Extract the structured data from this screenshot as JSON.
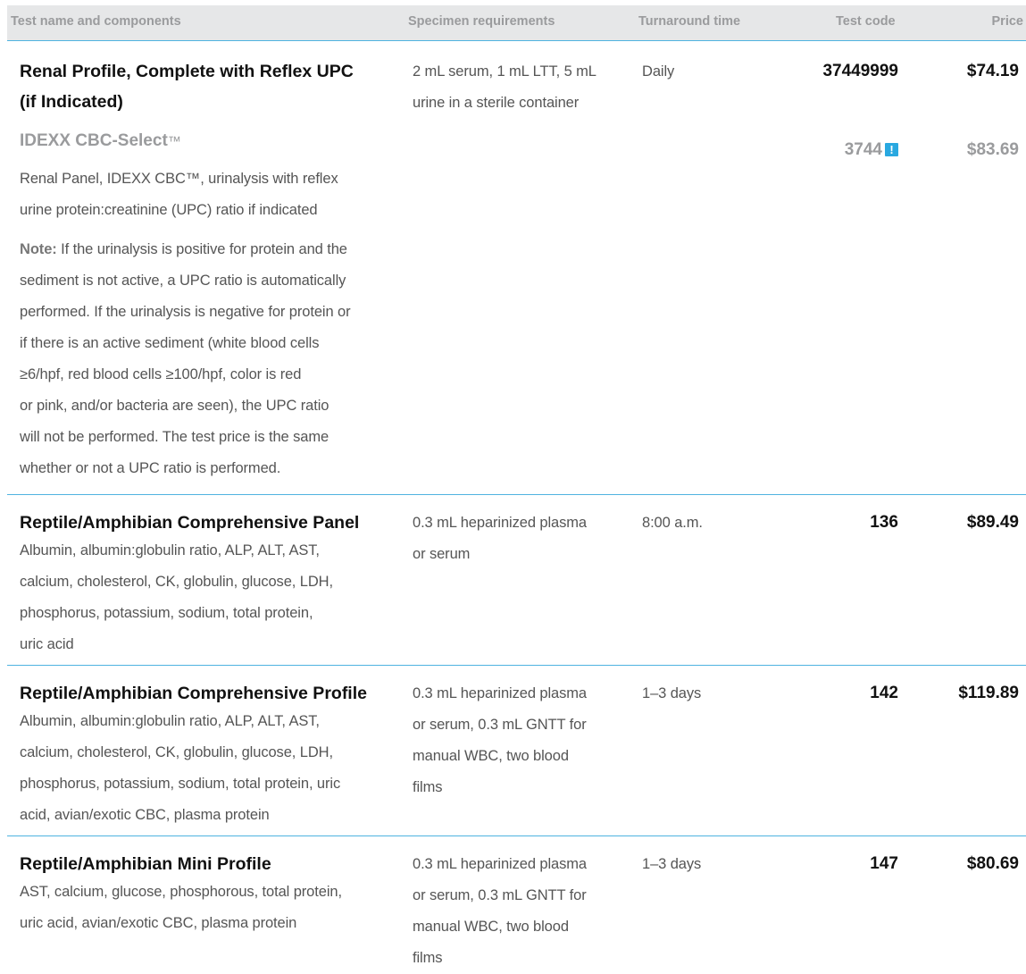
{
  "header": {
    "name": "Test name and components",
    "specimen": "Specimen requirements",
    "turnaround": "Turnaround time",
    "code": "Test code",
    "price": "Price"
  },
  "rows": [
    {
      "title_lines": [
        "Renal Profile, Complete with Reflex UPC",
        "(if Indicated)"
      ],
      "specimen_lines": [
        "2 mL serum, 1 mL LTT, 5 mL",
        "urine in a sterile container"
      ],
      "turnaround": "Daily",
      "code": "37449999",
      "price": "$74.19",
      "variant": {
        "title": "IDEXX CBC-Select",
        "trademark": "™",
        "code": "3744",
        "icon": "exclamation-icon",
        "price": "$83.69"
      },
      "components_lines": [
        "Renal Panel, IDEXX CBC™, urinalysis with reflex",
        "urine protein:creatinine (UPC) ratio if indicated"
      ],
      "note_label": "Note:",
      "note_lines": [
        " If the urinalysis is positive for protein and the",
        "sediment is not active, a UPC ratio is automatically",
        "performed. If the urinalysis is negative for protein or",
        "if there is an active sediment (white blood cells",
        "≥6/hpf, red blood cells ≥100/hpf, color is red",
        "or pink, and/or bacteria are seen), the UPC ratio",
        "will not be performed. The test price is the same",
        "whether or not a UPC ratio is performed."
      ]
    },
    {
      "title": "Reptile/Amphibian Comprehensive Panel",
      "components_lines": [
        "Albumin, albumin:globulin ratio, ALP, ALT, AST,",
        "calcium, cholesterol, CK, globulin, glucose, LDH,",
        "phosphorus, potassium, sodium, total protein,",
        "uric acid"
      ],
      "specimen_lines": [
        "0.3 mL heparinized plasma",
        "or serum"
      ],
      "turnaround": "8:00 a.m.",
      "code": "136",
      "price": "$89.49"
    },
    {
      "title": "Reptile/Amphibian Comprehensive Profile",
      "components_lines": [
        "Albumin, albumin:globulin ratio, ALP, ALT, AST,",
        "calcium, cholesterol, CK, globulin, glucose, LDH,",
        "phosphorus, potassium, sodium, total protein, uric",
        "acid, avian/exotic CBC, plasma protein"
      ],
      "specimen_lines": [
        "0.3 mL heparinized plasma",
        "or serum, 0.3 mL GNTT for",
        "manual WBC, two blood",
        "films"
      ],
      "turnaround": "1–3 days",
      "code": "142",
      "price": "$119.89"
    },
    {
      "title": "Reptile/Amphibian Mini Profile",
      "components_lines": [
        "AST, calcium, glucose, phosphorous, total protein,",
        "uric acid, avian/exotic CBC, plasma protein"
      ],
      "specimen_lines": [
        "0.3 mL heparinized plasma",
        "or serum, 0.3 mL GNTT for",
        "manual WBC, two blood",
        "films"
      ],
      "turnaround": "1–3 days",
      "code": "147",
      "price": "$80.69"
    }
  ]
}
